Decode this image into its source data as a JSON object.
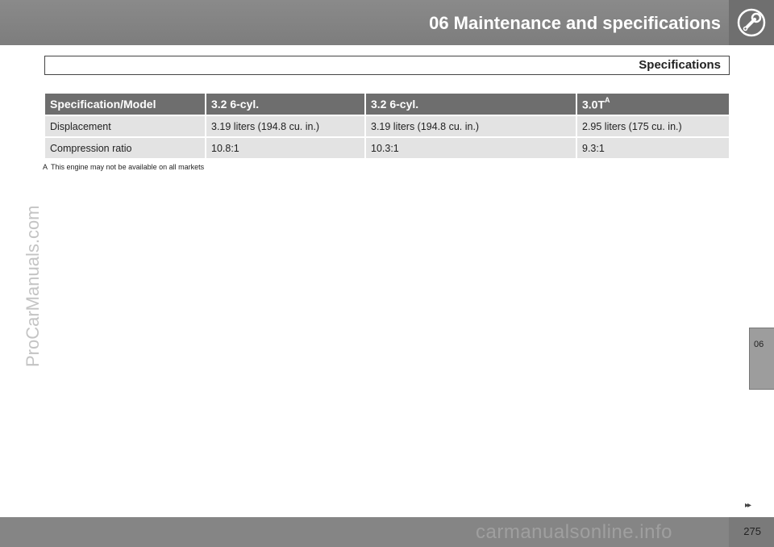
{
  "header": {
    "title": "06 Maintenance and specifications",
    "icon": "wrench-icon"
  },
  "section": {
    "title": "Specifications"
  },
  "table": {
    "headers": [
      "Specification/Model",
      "3.2 6-cyl.",
      "3.2 6-cyl.",
      "3.0T"
    ],
    "header_superscript": "A",
    "rows": [
      [
        "Displacement",
        "3.19 liters (194.8 cu. in.)",
        "3.19 liters (194.8 cu. in.)",
        "2.95 liters (175 cu. in.)"
      ],
      [
        "Compression ratio",
        "10.8:1",
        "10.3:1",
        "9.3:1"
      ]
    ]
  },
  "footnote": {
    "mark": "A",
    "text": "This engine may not be available on all markets"
  },
  "side_tab": {
    "label": "06"
  },
  "nav": {
    "next": "▸▸"
  },
  "footer": {
    "page_number": "275"
  },
  "watermarks": {
    "left": "ProCarManuals.com",
    "bottom": "carmanualsonline.info"
  }
}
